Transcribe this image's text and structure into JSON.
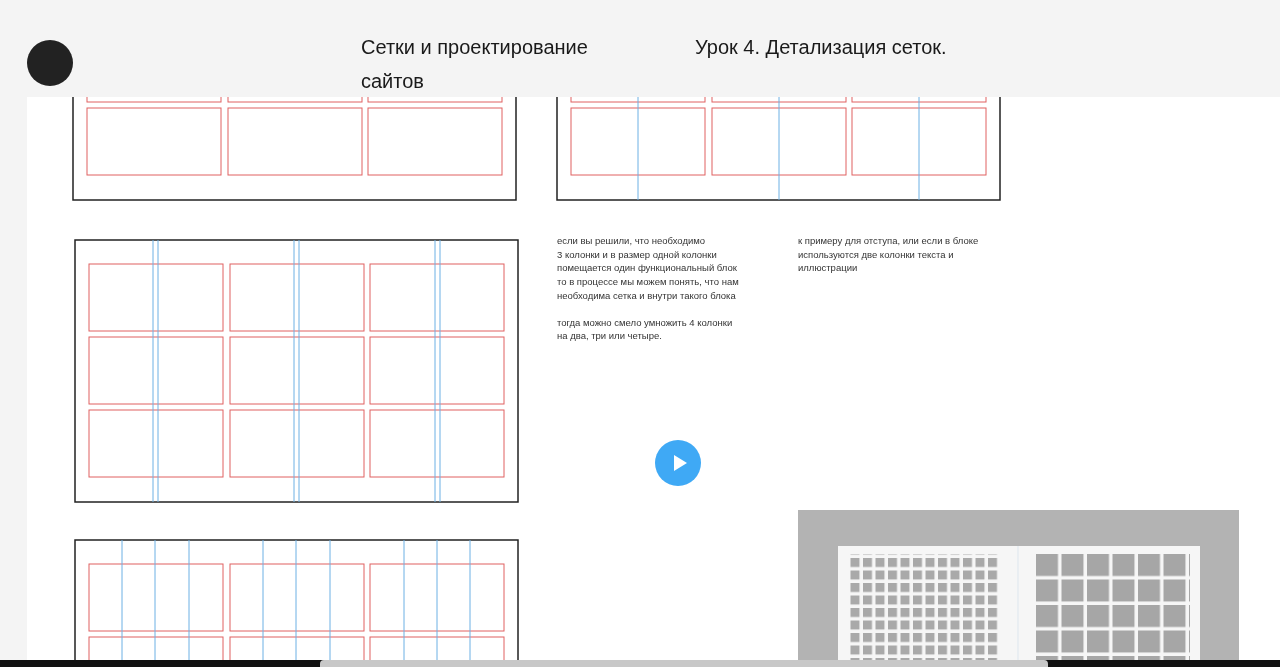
{
  "header": {
    "course_title": "Сетки и проектирование сайтов",
    "lesson_title": "Урок 4. Детализация сеток."
  },
  "slide": {
    "text_left": [
      "если вы решили, что необходимо\n3 колонки и в размер одной колонки\nпомещается один функциональный блок\nто в процессе мы можем понять, что нам\nнеобходима сетка и внутри такого блока",
      "тогда можно смело умножить 4 колонки\nна два, три или четыре."
    ],
    "text_right": "к примеру для отступа, или если в блоке\nиспользуются две колонки текста и\nиллюстрации"
  }
}
